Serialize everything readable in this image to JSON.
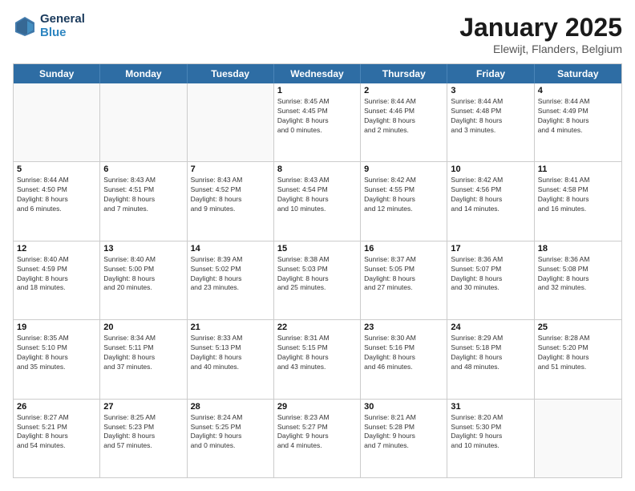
{
  "header": {
    "logo_line1": "General",
    "logo_line2": "Blue",
    "title": "January 2025",
    "subtitle": "Elewijt, Flanders, Belgium"
  },
  "days_of_week": [
    "Sunday",
    "Monday",
    "Tuesday",
    "Wednesday",
    "Thursday",
    "Friday",
    "Saturday"
  ],
  "weeks": [
    [
      {
        "day": "",
        "lines": []
      },
      {
        "day": "",
        "lines": []
      },
      {
        "day": "",
        "lines": []
      },
      {
        "day": "1",
        "lines": [
          "Sunrise: 8:45 AM",
          "Sunset: 4:45 PM",
          "Daylight: 8 hours",
          "and 0 minutes."
        ]
      },
      {
        "day": "2",
        "lines": [
          "Sunrise: 8:44 AM",
          "Sunset: 4:46 PM",
          "Daylight: 8 hours",
          "and 2 minutes."
        ]
      },
      {
        "day": "3",
        "lines": [
          "Sunrise: 8:44 AM",
          "Sunset: 4:48 PM",
          "Daylight: 8 hours",
          "and 3 minutes."
        ]
      },
      {
        "day": "4",
        "lines": [
          "Sunrise: 8:44 AM",
          "Sunset: 4:49 PM",
          "Daylight: 8 hours",
          "and 4 minutes."
        ]
      }
    ],
    [
      {
        "day": "5",
        "lines": [
          "Sunrise: 8:44 AM",
          "Sunset: 4:50 PM",
          "Daylight: 8 hours",
          "and 6 minutes."
        ]
      },
      {
        "day": "6",
        "lines": [
          "Sunrise: 8:43 AM",
          "Sunset: 4:51 PM",
          "Daylight: 8 hours",
          "and 7 minutes."
        ]
      },
      {
        "day": "7",
        "lines": [
          "Sunrise: 8:43 AM",
          "Sunset: 4:52 PM",
          "Daylight: 8 hours",
          "and 9 minutes."
        ]
      },
      {
        "day": "8",
        "lines": [
          "Sunrise: 8:43 AM",
          "Sunset: 4:54 PM",
          "Daylight: 8 hours",
          "and 10 minutes."
        ]
      },
      {
        "day": "9",
        "lines": [
          "Sunrise: 8:42 AM",
          "Sunset: 4:55 PM",
          "Daylight: 8 hours",
          "and 12 minutes."
        ]
      },
      {
        "day": "10",
        "lines": [
          "Sunrise: 8:42 AM",
          "Sunset: 4:56 PM",
          "Daylight: 8 hours",
          "and 14 minutes."
        ]
      },
      {
        "day": "11",
        "lines": [
          "Sunrise: 8:41 AM",
          "Sunset: 4:58 PM",
          "Daylight: 8 hours",
          "and 16 minutes."
        ]
      }
    ],
    [
      {
        "day": "12",
        "lines": [
          "Sunrise: 8:40 AM",
          "Sunset: 4:59 PM",
          "Daylight: 8 hours",
          "and 18 minutes."
        ]
      },
      {
        "day": "13",
        "lines": [
          "Sunrise: 8:40 AM",
          "Sunset: 5:00 PM",
          "Daylight: 8 hours",
          "and 20 minutes."
        ]
      },
      {
        "day": "14",
        "lines": [
          "Sunrise: 8:39 AM",
          "Sunset: 5:02 PM",
          "Daylight: 8 hours",
          "and 23 minutes."
        ]
      },
      {
        "day": "15",
        "lines": [
          "Sunrise: 8:38 AM",
          "Sunset: 5:03 PM",
          "Daylight: 8 hours",
          "and 25 minutes."
        ]
      },
      {
        "day": "16",
        "lines": [
          "Sunrise: 8:37 AM",
          "Sunset: 5:05 PM",
          "Daylight: 8 hours",
          "and 27 minutes."
        ]
      },
      {
        "day": "17",
        "lines": [
          "Sunrise: 8:36 AM",
          "Sunset: 5:07 PM",
          "Daylight: 8 hours",
          "and 30 minutes."
        ]
      },
      {
        "day": "18",
        "lines": [
          "Sunrise: 8:36 AM",
          "Sunset: 5:08 PM",
          "Daylight: 8 hours",
          "and 32 minutes."
        ]
      }
    ],
    [
      {
        "day": "19",
        "lines": [
          "Sunrise: 8:35 AM",
          "Sunset: 5:10 PM",
          "Daylight: 8 hours",
          "and 35 minutes."
        ]
      },
      {
        "day": "20",
        "lines": [
          "Sunrise: 8:34 AM",
          "Sunset: 5:11 PM",
          "Daylight: 8 hours",
          "and 37 minutes."
        ]
      },
      {
        "day": "21",
        "lines": [
          "Sunrise: 8:33 AM",
          "Sunset: 5:13 PM",
          "Daylight: 8 hours",
          "and 40 minutes."
        ]
      },
      {
        "day": "22",
        "lines": [
          "Sunrise: 8:31 AM",
          "Sunset: 5:15 PM",
          "Daylight: 8 hours",
          "and 43 minutes."
        ]
      },
      {
        "day": "23",
        "lines": [
          "Sunrise: 8:30 AM",
          "Sunset: 5:16 PM",
          "Daylight: 8 hours",
          "and 46 minutes."
        ]
      },
      {
        "day": "24",
        "lines": [
          "Sunrise: 8:29 AM",
          "Sunset: 5:18 PM",
          "Daylight: 8 hours",
          "and 48 minutes."
        ]
      },
      {
        "day": "25",
        "lines": [
          "Sunrise: 8:28 AM",
          "Sunset: 5:20 PM",
          "Daylight: 8 hours",
          "and 51 minutes."
        ]
      }
    ],
    [
      {
        "day": "26",
        "lines": [
          "Sunrise: 8:27 AM",
          "Sunset: 5:21 PM",
          "Daylight: 8 hours",
          "and 54 minutes."
        ]
      },
      {
        "day": "27",
        "lines": [
          "Sunrise: 8:25 AM",
          "Sunset: 5:23 PM",
          "Daylight: 8 hours",
          "and 57 minutes."
        ]
      },
      {
        "day": "28",
        "lines": [
          "Sunrise: 8:24 AM",
          "Sunset: 5:25 PM",
          "Daylight: 9 hours",
          "and 0 minutes."
        ]
      },
      {
        "day": "29",
        "lines": [
          "Sunrise: 8:23 AM",
          "Sunset: 5:27 PM",
          "Daylight: 9 hours",
          "and 4 minutes."
        ]
      },
      {
        "day": "30",
        "lines": [
          "Sunrise: 8:21 AM",
          "Sunset: 5:28 PM",
          "Daylight: 9 hours",
          "and 7 minutes."
        ]
      },
      {
        "day": "31",
        "lines": [
          "Sunrise: 8:20 AM",
          "Sunset: 5:30 PM",
          "Daylight: 9 hours",
          "and 10 minutes."
        ]
      },
      {
        "day": "",
        "lines": []
      }
    ]
  ]
}
